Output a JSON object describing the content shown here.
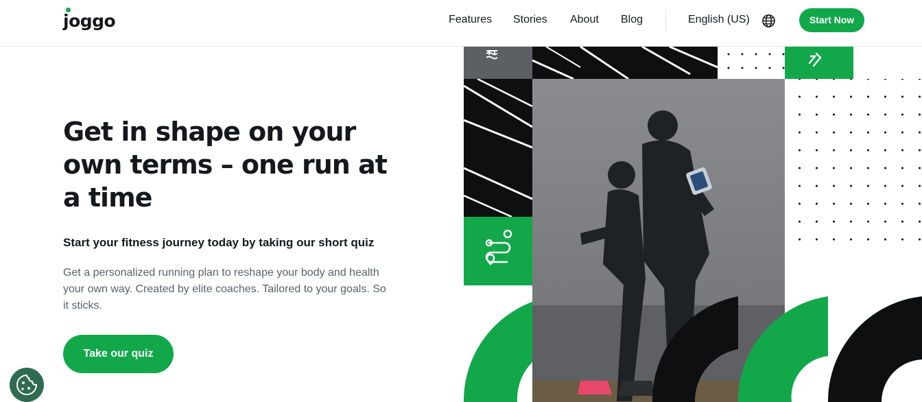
{
  "brand": {
    "name": "joggo",
    "accent": "#12a84a",
    "dark": "#15181c"
  },
  "nav": {
    "items": [
      "Features",
      "Stories",
      "About",
      "Blog"
    ],
    "language": "English (US)",
    "globe_icon": "globe-icon",
    "cta": "Start Now"
  },
  "hero": {
    "title": "Get in shape on your own terms – one run at a time",
    "subtitle": "Start your fitness journey today by taking our short quiz",
    "description": "Get a personalized running plan to reshape your body and health your own way. Created by elite coaches. Tailored to your goals. So it sticks.",
    "cta": "Take our quiz"
  },
  "collage": {
    "icons": [
      "swim-icon",
      "route-icon",
      "double-chevron-icon"
    ],
    "photo": "runners-photo"
  },
  "cookie": {
    "icon": "cookie-icon"
  }
}
